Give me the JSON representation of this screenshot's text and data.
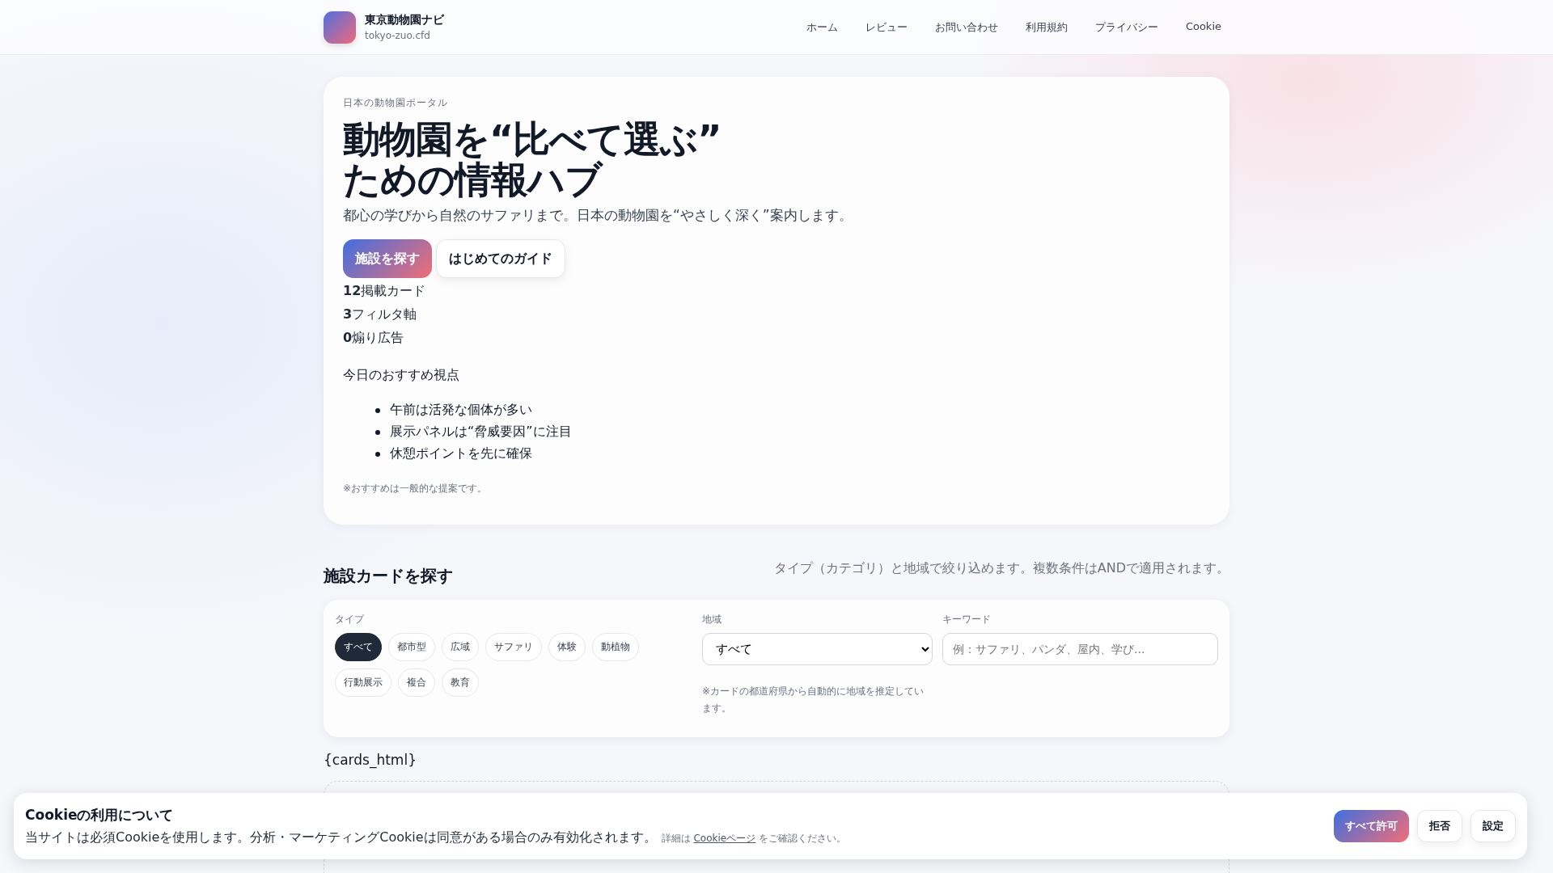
{
  "header": {
    "logo_title": "東京動物園ナビ",
    "domain": "tokyo-zuo.cfd",
    "nav": [
      "ホーム",
      "レビュー",
      "お問い合わせ",
      "利用規約",
      "プライバシー",
      "Cookie"
    ]
  },
  "hero": {
    "eyebrow": "日本の動物園ポータル",
    "title_lines": [
      "動物園を“比べて選ぶ”",
      "ための情報ハブ"
    ],
    "lead": "都心の学びから自然のサファリまで。日本の動物園を“やさしく深く”案内します。",
    "buttons": [
      {
        "label": "施設を探す",
        "kind": "primary"
      },
      {
        "label": "はじめてのガイド",
        "kind": "secondary"
      }
    ],
    "stats": [
      "**12**掲載カード",
      "**3**フィルタ軸",
      "**0**煽り広告"
    ],
    "picks_title": "今日のおすすめ視点",
    "picks": [
      "午前は活発な個体が多い",
      "展示パネルは“脅威要因”に注目",
      "休憩ポイントを先に確保"
    ],
    "note": "※おすすめは一般的な提案です。"
  },
  "search": {
    "title": "施設カードを探す",
    "description": "タイプ（カテゴリ）と地域で絞り込めます。複数条件はANDで適用されます。",
    "type_label": "タイプ",
    "chips": [
      {
        "label": "すべて",
        "selected": true
      },
      {
        "label": "都市型",
        "selected": false
      },
      {
        "label": "広域",
        "selected": false
      },
      {
        "label": "サファリ",
        "selected": false
      },
      {
        "label": "体験",
        "selected": false
      },
      {
        "label": "動植物",
        "selected": false
      },
      {
        "label": "行動展示",
        "selected": false
      },
      {
        "label": "複合",
        "selected": false
      },
      {
        "label": "教育",
        "selected": false
      }
    ],
    "region_label": "地域",
    "region_value": "すべて",
    "region_note": "※カードの都道府県から自動的に地域を推定しています。",
    "keyword_label": "キーワード",
    "keyword_placeholder": "例：サファリ、パンダ、屋内、学び..."
  },
  "template_text": "{cards_html}",
  "cookie_banner": {
    "title": "Cookieの利用について",
    "text": "当サイトは必須Cookieを使用します。分析・マーケティングCookieは同意がある場合のみ有効化されます。",
    "detail_prefix": "詳細は",
    "link": "Cookieページ",
    "detail_suffix": "をご確認ください。",
    "buttons": [
      {
        "label": "すべて許可",
        "kind": "primary"
      },
      {
        "label": "拒否",
        "kind": "secondary"
      },
      {
        "label": "設定",
        "kind": "secondary"
      }
    ]
  }
}
